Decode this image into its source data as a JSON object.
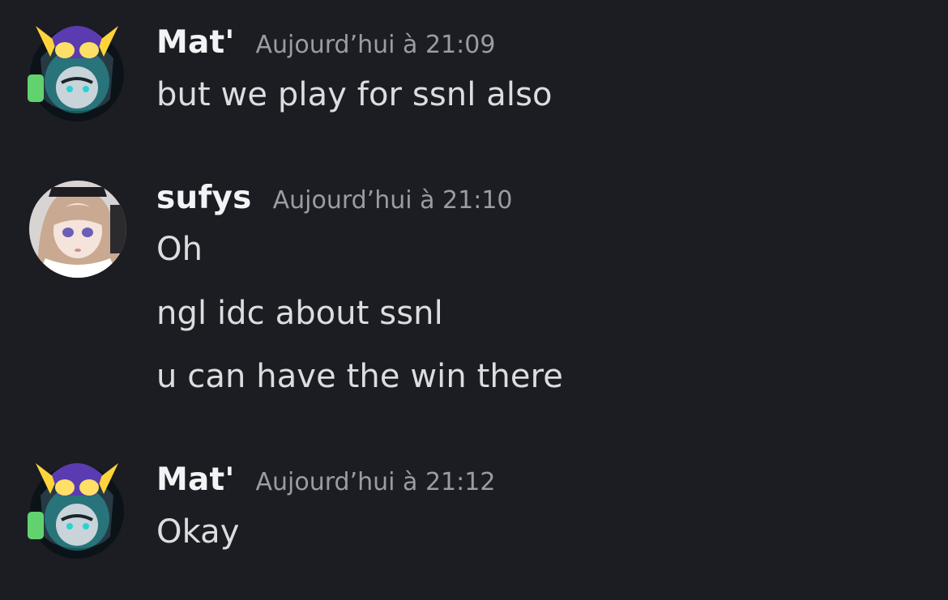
{
  "messages": [
    {
      "author": "Mat'",
      "timestamp": "Aujourd’hui à 21:09",
      "avatar_icon": "owl-mask-avatar",
      "lines": [
        "but we play for ssnl also"
      ]
    },
    {
      "author": "sufys",
      "timestamp": "Aujourd’hui à 21:10",
      "avatar_icon": "anime-girl-avatar",
      "lines": [
        "Oh",
        "ngl idc about ssnl",
        "u can have the win there"
      ]
    },
    {
      "author": "Mat'",
      "timestamp": "Aujourd’hui à 21:12",
      "avatar_icon": "owl-mask-avatar",
      "lines": [
        "Okay"
      ]
    }
  ],
  "colors": {
    "background": "#1c1d22",
    "username": "#f2f3f5",
    "timestamp": "#9a9ca4",
    "message": "#dcdde1"
  }
}
